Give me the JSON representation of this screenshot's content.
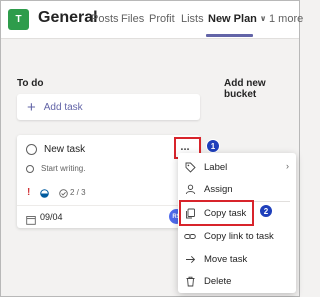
{
  "header": {
    "team_initial": "T",
    "channel": "General",
    "tabs": [
      "Posts",
      "Files",
      "Profit",
      "Lists",
      "New Plan"
    ],
    "more": "1 more",
    "active_tab_index": 4
  },
  "board": {
    "bucket_title": "To do",
    "add_bucket": "Add new bucket",
    "add_task": "Add task"
  },
  "task": {
    "name": "New task",
    "description_placeholder": "Start writing.",
    "checklist": "2 / 3",
    "due_date": "09/04",
    "assignee_initials": "RS",
    "more": "..."
  },
  "context_menu": {
    "items": [
      {
        "label": "Label",
        "icon": "tag-icon",
        "submenu": true
      },
      {
        "label": "Assign",
        "icon": "assign-person-icon"
      },
      {
        "label": "Copy task",
        "icon": "copy-icon"
      },
      {
        "label": "Copy link to task",
        "icon": "link-icon"
      },
      {
        "label": "Move task",
        "icon": "move-arrow-icon"
      },
      {
        "label": "Delete",
        "icon": "trash-icon"
      }
    ]
  },
  "annotations": {
    "step1": "1",
    "step2": "2",
    "highlight_color": "#d8242b",
    "badge_color": "#1e3fbb"
  },
  "colors": {
    "accent": "#6264a7",
    "team_avatar": "#2e9c4b",
    "priority_urgent": "#d13438",
    "assignee_avatar": "#4f6bed"
  }
}
